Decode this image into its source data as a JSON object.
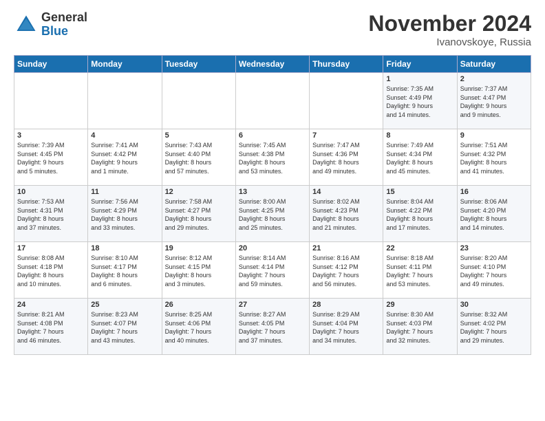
{
  "header": {
    "logo_line1": "General",
    "logo_line2": "Blue",
    "month": "November 2024",
    "location": "Ivanovskoye, Russia"
  },
  "days_of_week": [
    "Sunday",
    "Monday",
    "Tuesday",
    "Wednesday",
    "Thursday",
    "Friday",
    "Saturday"
  ],
  "weeks": [
    [
      {
        "day": "",
        "info": ""
      },
      {
        "day": "",
        "info": ""
      },
      {
        "day": "",
        "info": ""
      },
      {
        "day": "",
        "info": ""
      },
      {
        "day": "",
        "info": ""
      },
      {
        "day": "1",
        "info": "Sunrise: 7:35 AM\nSunset: 4:49 PM\nDaylight: 9 hours\nand 14 minutes."
      },
      {
        "day": "2",
        "info": "Sunrise: 7:37 AM\nSunset: 4:47 PM\nDaylight: 9 hours\nand 9 minutes."
      }
    ],
    [
      {
        "day": "3",
        "info": "Sunrise: 7:39 AM\nSunset: 4:45 PM\nDaylight: 9 hours\nand 5 minutes."
      },
      {
        "day": "4",
        "info": "Sunrise: 7:41 AM\nSunset: 4:42 PM\nDaylight: 9 hours\nand 1 minute."
      },
      {
        "day": "5",
        "info": "Sunrise: 7:43 AM\nSunset: 4:40 PM\nDaylight: 8 hours\nand 57 minutes."
      },
      {
        "day": "6",
        "info": "Sunrise: 7:45 AM\nSunset: 4:38 PM\nDaylight: 8 hours\nand 53 minutes."
      },
      {
        "day": "7",
        "info": "Sunrise: 7:47 AM\nSunset: 4:36 PM\nDaylight: 8 hours\nand 49 minutes."
      },
      {
        "day": "8",
        "info": "Sunrise: 7:49 AM\nSunset: 4:34 PM\nDaylight: 8 hours\nand 45 minutes."
      },
      {
        "day": "9",
        "info": "Sunrise: 7:51 AM\nSunset: 4:32 PM\nDaylight: 8 hours\nand 41 minutes."
      }
    ],
    [
      {
        "day": "10",
        "info": "Sunrise: 7:53 AM\nSunset: 4:31 PM\nDaylight: 8 hours\nand 37 minutes."
      },
      {
        "day": "11",
        "info": "Sunrise: 7:56 AM\nSunset: 4:29 PM\nDaylight: 8 hours\nand 33 minutes."
      },
      {
        "day": "12",
        "info": "Sunrise: 7:58 AM\nSunset: 4:27 PM\nDaylight: 8 hours\nand 29 minutes."
      },
      {
        "day": "13",
        "info": "Sunrise: 8:00 AM\nSunset: 4:25 PM\nDaylight: 8 hours\nand 25 minutes."
      },
      {
        "day": "14",
        "info": "Sunrise: 8:02 AM\nSunset: 4:23 PM\nDaylight: 8 hours\nand 21 minutes."
      },
      {
        "day": "15",
        "info": "Sunrise: 8:04 AM\nSunset: 4:22 PM\nDaylight: 8 hours\nand 17 minutes."
      },
      {
        "day": "16",
        "info": "Sunrise: 8:06 AM\nSunset: 4:20 PM\nDaylight: 8 hours\nand 14 minutes."
      }
    ],
    [
      {
        "day": "17",
        "info": "Sunrise: 8:08 AM\nSunset: 4:18 PM\nDaylight: 8 hours\nand 10 minutes."
      },
      {
        "day": "18",
        "info": "Sunrise: 8:10 AM\nSunset: 4:17 PM\nDaylight: 8 hours\nand 6 minutes."
      },
      {
        "day": "19",
        "info": "Sunrise: 8:12 AM\nSunset: 4:15 PM\nDaylight: 8 hours\nand 3 minutes."
      },
      {
        "day": "20",
        "info": "Sunrise: 8:14 AM\nSunset: 4:14 PM\nDaylight: 7 hours\nand 59 minutes."
      },
      {
        "day": "21",
        "info": "Sunrise: 8:16 AM\nSunset: 4:12 PM\nDaylight: 7 hours\nand 56 minutes."
      },
      {
        "day": "22",
        "info": "Sunrise: 8:18 AM\nSunset: 4:11 PM\nDaylight: 7 hours\nand 53 minutes."
      },
      {
        "day": "23",
        "info": "Sunrise: 8:20 AM\nSunset: 4:10 PM\nDaylight: 7 hours\nand 49 minutes."
      }
    ],
    [
      {
        "day": "24",
        "info": "Sunrise: 8:21 AM\nSunset: 4:08 PM\nDaylight: 7 hours\nand 46 minutes."
      },
      {
        "day": "25",
        "info": "Sunrise: 8:23 AM\nSunset: 4:07 PM\nDaylight: 7 hours\nand 43 minutes."
      },
      {
        "day": "26",
        "info": "Sunrise: 8:25 AM\nSunset: 4:06 PM\nDaylight: 7 hours\nand 40 minutes."
      },
      {
        "day": "27",
        "info": "Sunrise: 8:27 AM\nSunset: 4:05 PM\nDaylight: 7 hours\nand 37 minutes."
      },
      {
        "day": "28",
        "info": "Sunrise: 8:29 AM\nSunset: 4:04 PM\nDaylight: 7 hours\nand 34 minutes."
      },
      {
        "day": "29",
        "info": "Sunrise: 8:30 AM\nSunset: 4:03 PM\nDaylight: 7 hours\nand 32 minutes."
      },
      {
        "day": "30",
        "info": "Sunrise: 8:32 AM\nSunset: 4:02 PM\nDaylight: 7 hours\nand 29 minutes."
      }
    ]
  ]
}
